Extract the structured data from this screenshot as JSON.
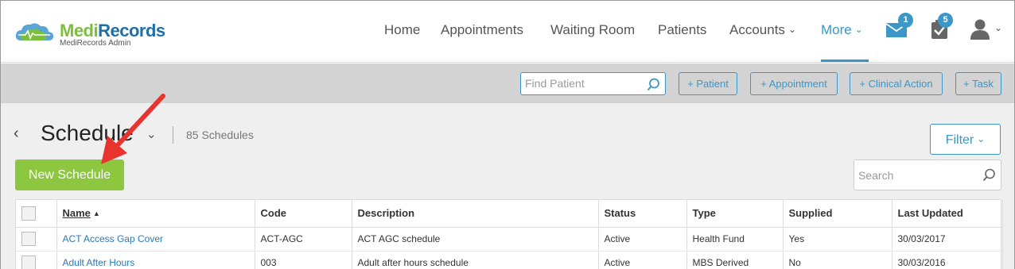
{
  "app": {
    "logo_title_1": "Medi",
    "logo_title_2": "Records",
    "logo_subtitle": "MediRecords Admin"
  },
  "nav": {
    "items": [
      {
        "label": "Home"
      },
      {
        "label": "Appointments"
      },
      {
        "label": "Waiting Room"
      },
      {
        "label": "Patients"
      },
      {
        "label": "Accounts",
        "dropdown": true
      },
      {
        "label": "More",
        "dropdown": true,
        "active": true
      }
    ],
    "messages_badge": "1",
    "tasks_badge": "5"
  },
  "actionbar": {
    "find_patient_placeholder": "Find Patient",
    "buttons": [
      "+ Patient",
      "+ Appointment",
      "+ Clinical Action",
      "+ Task"
    ]
  },
  "page": {
    "title": "Schedule",
    "count": "85 Schedules",
    "new_button": "New Schedule",
    "filter_button": "Filter",
    "search_placeholder": "Search"
  },
  "table": {
    "headers": [
      "Name",
      "Code",
      "Description",
      "Status",
      "Type",
      "Supplied",
      "Last Updated"
    ],
    "sorted_column": "Name",
    "rows": [
      [
        "ACT Access Gap Cover",
        "ACT-AGC",
        "ACT AGC schedule",
        "Active",
        "Health Fund",
        "Yes",
        "30/03/2017"
      ],
      [
        "Adult After Hours",
        "003",
        "Adult after hours schedule",
        "Active",
        "MBS Derived",
        "No",
        "30/03/2016"
      ]
    ]
  },
  "colors": {
    "accent": "#3a97c8",
    "primary_button": "#8dc63f",
    "logo_green": "#7bbf3a",
    "logo_blue": "#1f6fa8",
    "annotation_arrow": "#e8342f"
  },
  "icons": [
    "logo-cloud-icon",
    "chevron-down-icon",
    "envelope-icon",
    "clipboard-check-icon",
    "user-icon",
    "search-icon",
    "back-chevron-icon",
    "sort-asc-icon"
  ]
}
